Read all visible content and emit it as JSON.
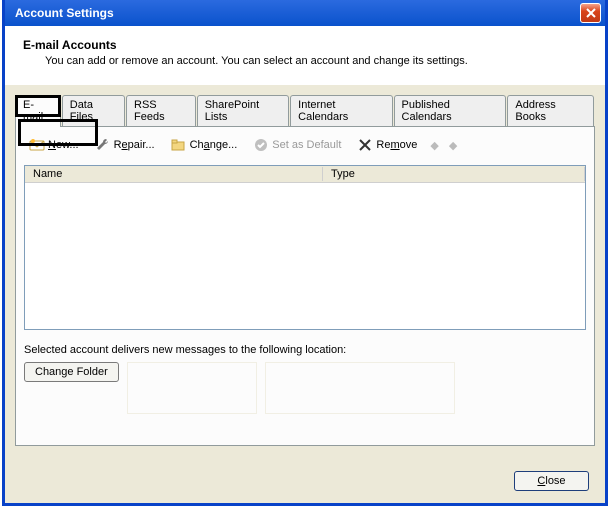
{
  "window": {
    "title": "Account Settings"
  },
  "header": {
    "title": "E-mail Accounts",
    "subtitle": "You can add or remove an account. You can select an account and change its settings."
  },
  "tabs": {
    "items": [
      {
        "label": "E-mail"
      },
      {
        "label": "Data Files"
      },
      {
        "label": "RSS Feeds"
      },
      {
        "label": "SharePoint Lists"
      },
      {
        "label": "Internet Calendars"
      },
      {
        "label": "Published Calendars"
      },
      {
        "label": "Address Books"
      }
    ]
  },
  "toolbar": {
    "new_label": "New...",
    "repair_label": "Repair...",
    "change_label": "Change...",
    "default_label": "Set as Default",
    "remove_label": "Remove"
  },
  "columns": {
    "name": "Name",
    "type": "Type"
  },
  "location_text": "Selected account delivers new messages to the following location:",
  "change_folder_label": "Change Folder",
  "close_label": "Close"
}
